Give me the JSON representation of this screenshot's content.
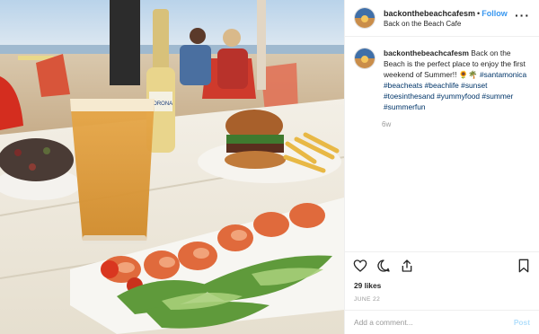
{
  "header": {
    "username": "backonthebeachcafesm",
    "separator": "•",
    "follow_label": "Follow",
    "location": "Back on the Beach Cafe",
    "more_icon": "more-horizontal-icon"
  },
  "caption": {
    "username": "backonthebeachcafesm",
    "text": "Back on the Beach is the perfect place to enjoy the first weekend of Summer!! 🌻🌴",
    "hashtags": [
      "#santamonica",
      "#beacheats",
      "#beachlife",
      "#sunset",
      "#toesinthesand",
      "#yummyfood",
      "#summer",
      "#summerfun"
    ],
    "time_ago": "6w"
  },
  "actions": {
    "like_icon": "heart-icon",
    "comment_icon": "comment-icon",
    "share_icon": "share-icon",
    "save_icon": "bookmark-icon"
  },
  "likes": "29 likes",
  "date": "JUNE 22",
  "comment_box": {
    "placeholder": "Add a comment...",
    "post_label": "Post"
  },
  "colors": {
    "link": "#3897f0",
    "hashtag": "#003569",
    "muted": "#999999",
    "post_disabled": "#b2dffc"
  },
  "photo": {
    "bottle_label": "CORONA"
  }
}
